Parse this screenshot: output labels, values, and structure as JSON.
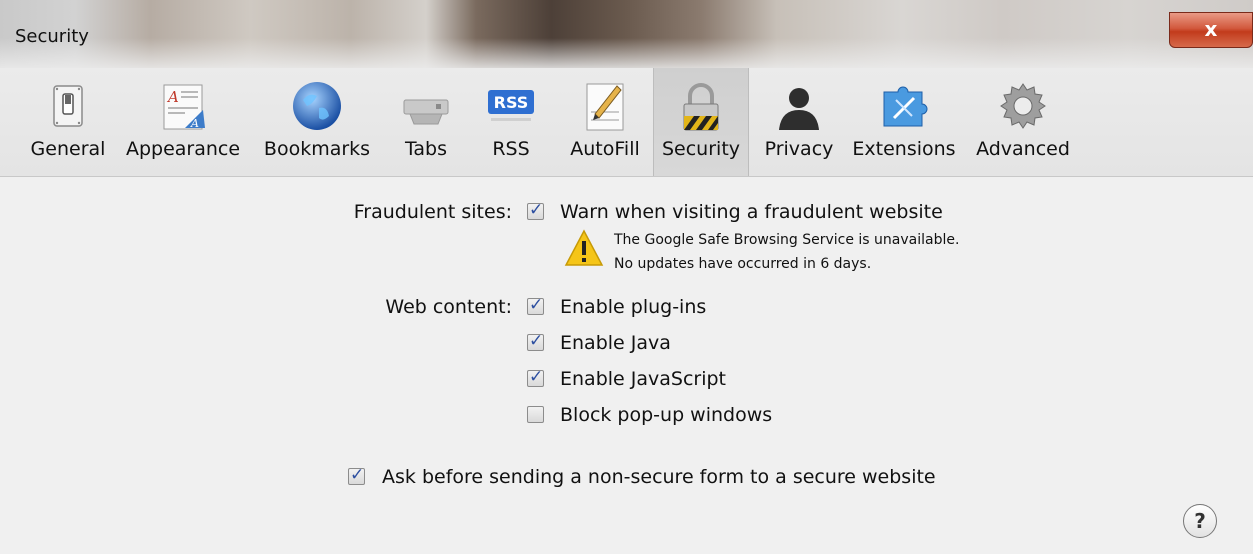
{
  "window": {
    "title": "Security",
    "close_label": "x"
  },
  "toolbar": {
    "items": [
      {
        "label": "General",
        "icon": "switch-icon"
      },
      {
        "label": "Appearance",
        "icon": "font-page-icon"
      },
      {
        "label": "Bookmarks",
        "icon": "globe-icon"
      },
      {
        "label": "Tabs",
        "icon": "tabs-icon"
      },
      {
        "label": "RSS",
        "icon": "rss-icon",
        "badge": "RSS"
      },
      {
        "label": "AutoFill",
        "icon": "pencil-form-icon"
      },
      {
        "label": "Security",
        "icon": "lock-icon",
        "selected": true
      },
      {
        "label": "Privacy",
        "icon": "person-silhouette-icon"
      },
      {
        "label": "Extensions",
        "icon": "puzzle-compass-icon"
      },
      {
        "label": "Advanced",
        "icon": "gear-icon"
      }
    ]
  },
  "fraudulent": {
    "label": "Fraudulent sites:",
    "checkbox_label": "Warn when visiting a fraudulent website",
    "checked": true,
    "warning_line1": "The Google Safe Browsing Service is unavailable.",
    "warning_line2": "No updates have occurred in 6 days."
  },
  "web_content": {
    "label": "Web content:",
    "options": [
      {
        "label": "Enable plug-ins",
        "checked": true
      },
      {
        "label": "Enable Java",
        "checked": true
      },
      {
        "label": "Enable JavaScript",
        "checked": true
      },
      {
        "label": "Block pop-up windows",
        "checked": false
      }
    ]
  },
  "non_secure_form": {
    "label": "Ask before sending a non-secure form to a secure website",
    "checked": true
  },
  "help": {
    "label": "?"
  },
  "colors": {
    "close_red": "#c23b1c",
    "check_blue": "#2d4fa0",
    "warning_yellow": "#f5c518"
  }
}
